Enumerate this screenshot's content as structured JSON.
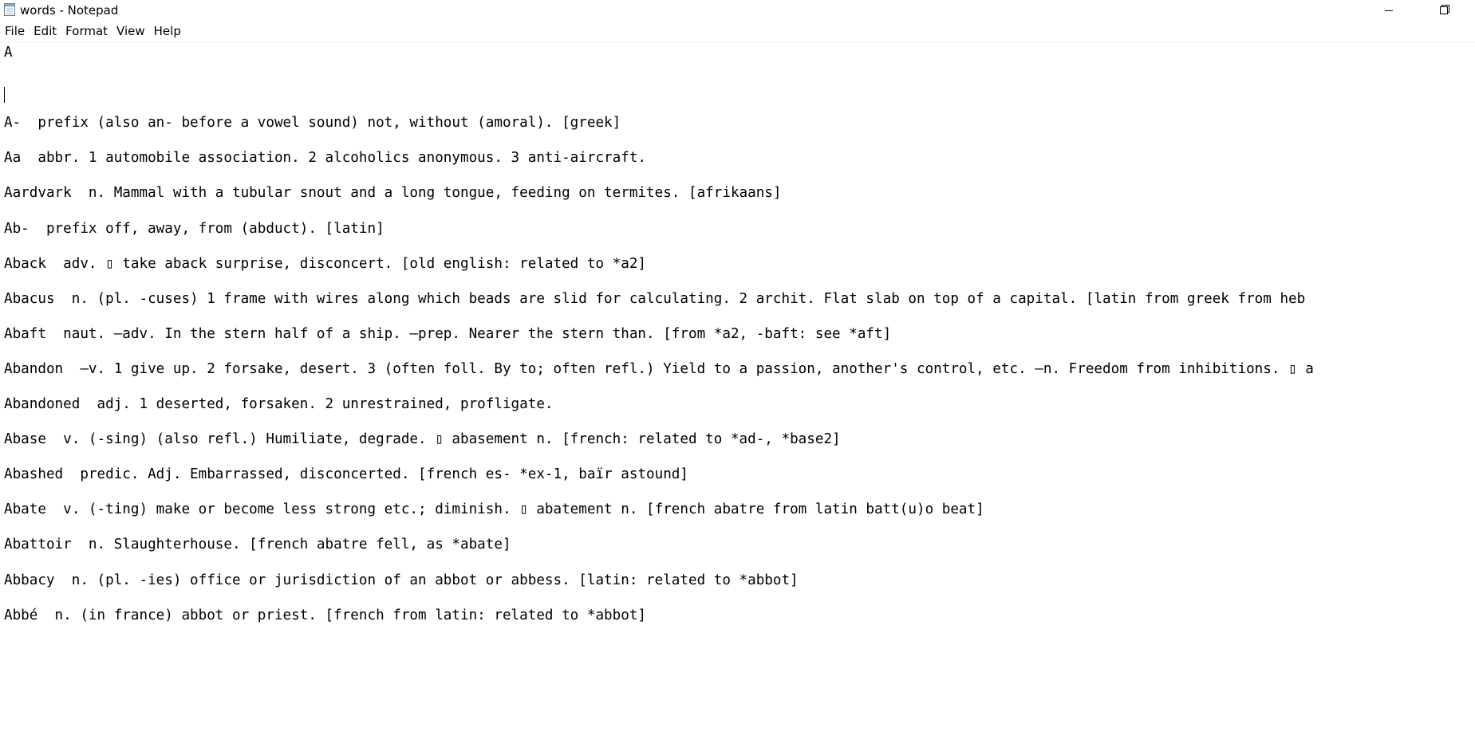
{
  "window": {
    "title": "words - Notepad",
    "icon": "notepad-icon",
    "controls": [
      "minimize-icon",
      "restore-icon"
    ]
  },
  "menu": {
    "items": [
      "File",
      "Edit",
      "Format",
      "View",
      "Help"
    ]
  },
  "editor": {
    "lines": [
      "A",
      "",
      "",
      "",
      "A-  prefix (also an- before a vowel sound) not, without (amoral). [greek]",
      "",
      "Aa  abbr. 1 automobile association. 2 alcoholics anonymous. 3 anti-aircraft.",
      "",
      "Aardvark  n. Mammal with a tubular snout and a long tongue, feeding on termites. [afrikaans]",
      "",
      "Ab-  prefix off, away, from (abduct). [latin]",
      "",
      "Aback  adv. ▯ take aback surprise, disconcert. [old english: related to *a2]",
      "",
      "Abacus  n. (pl. -cuses) 1 frame with wires along which beads are slid for calculating. 2 archit. Flat slab on top of a capital. [latin from greek from heb",
      "",
      "Abaft  naut. —adv. In the stern half of a ship. —prep. Nearer the stern than. [from *a2, -baft: see *aft]",
      "",
      "Abandon  —v. 1 give up. 2 forsake, desert. 3 (often foll. By to; often refl.) Yield to a passion, another's control, etc. —n. Freedom from inhibitions. ▯ a",
      "",
      "Abandoned  adj. 1 deserted, forsaken. 2 unrestrained, profligate.",
      "",
      "Abase  v. (-sing) (also refl.) Humiliate, degrade. ▯ abasement n. [french: related to *ad-, *base2]",
      "",
      "Abashed  predic. Adj. Embarrassed, disconcerted. [french es- *ex-1, baïr astound]",
      "",
      "Abate  v. (-ting) make or become less strong etc.; diminish. ▯ abatement n. [french abatre from latin batt(u)o beat]",
      "",
      "Abattoir  n. Slaughterhouse. [french abatre fell, as *abate]",
      "",
      "Abbacy  n. (pl. -ies) office or jurisdiction of an abbot or abbess. [latin: related to *abbot]",
      "",
      "Abbé  n. (in france) abbot or priest. [french from latin: related to *abbot]"
    ]
  }
}
